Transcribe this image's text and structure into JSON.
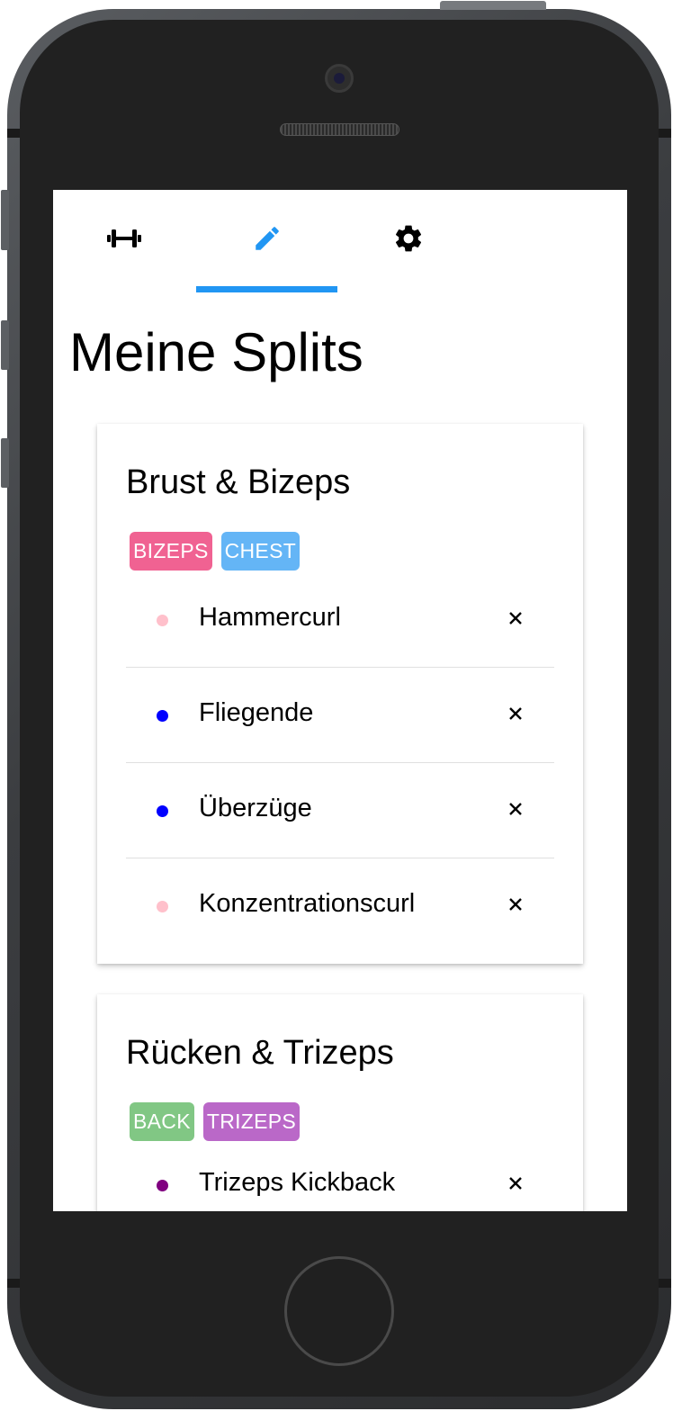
{
  "tabs": [
    {
      "name": "workout",
      "icon": "dumbbell-icon",
      "active": false
    },
    {
      "name": "edit",
      "icon": "pencil-icon",
      "active": true
    },
    {
      "name": "settings",
      "icon": "gear-icon",
      "active": false
    }
  ],
  "colors": {
    "accent": "#2196f3",
    "badge_bizeps": "#f06292",
    "badge_chest": "#64b5f6",
    "badge_back": "#81c784",
    "badge_trizeps": "#ba68c8",
    "dot_bizeps": "#ffc0cb",
    "dot_chest": "#0000ff",
    "dot_trizeps": "#800080"
  },
  "page": {
    "title": "Meine Splits"
  },
  "splits": [
    {
      "title": "Brust & Bizeps",
      "badges": [
        "BIZEPS",
        "CHEST"
      ],
      "exercises": [
        {
          "name": "Hammercurl"
        },
        {
          "name": "Fliegende"
        },
        {
          "name": "Überzüge"
        },
        {
          "name": "Konzentrationscurl"
        }
      ]
    },
    {
      "title": "Rücken & Trizeps",
      "badges": [
        "BACK",
        "TRIZEPS"
      ],
      "exercises": [
        {
          "name": "Trizeps Kickback"
        }
      ]
    }
  ],
  "delete_icon": "close-icon"
}
